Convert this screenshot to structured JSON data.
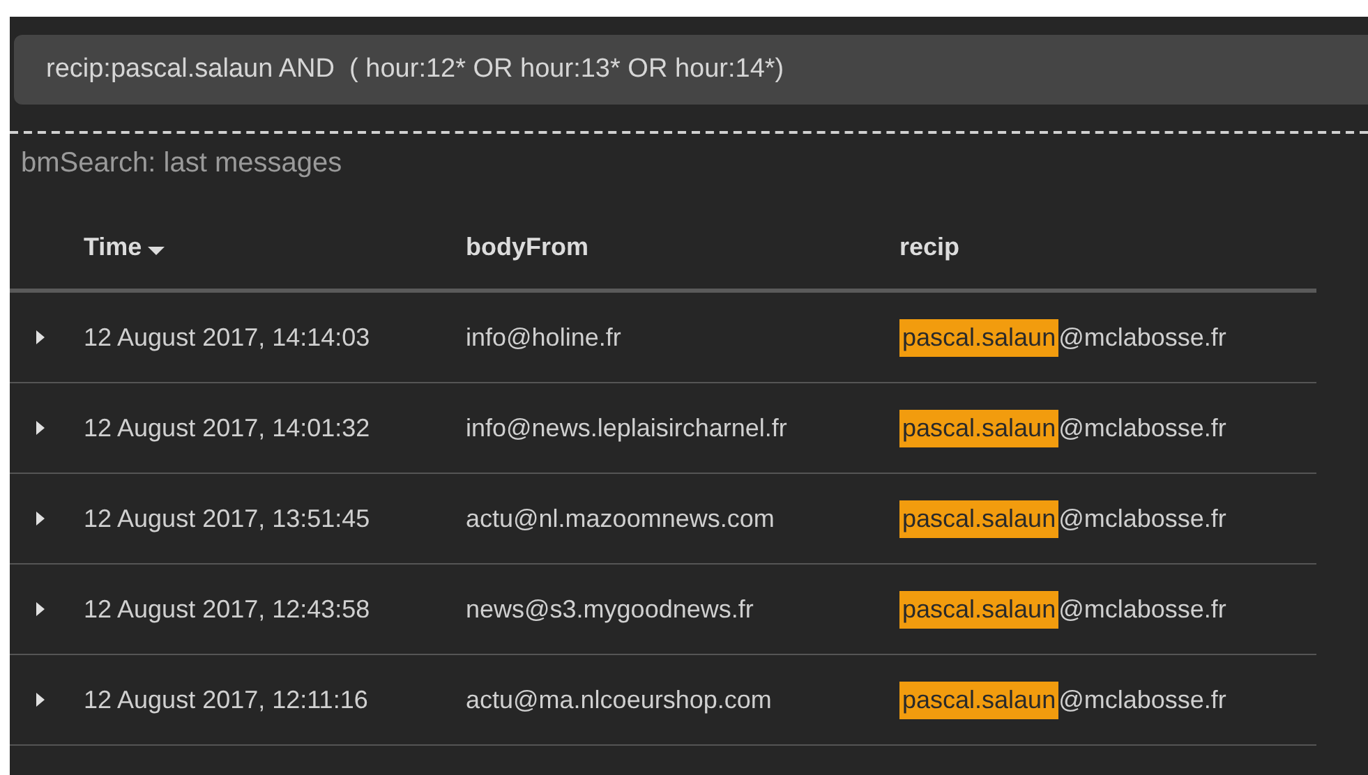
{
  "search": {
    "value": "recip:pascal.salaun AND  ( hour:12* OR hour:13* OR hour:14*)"
  },
  "panel_title": "bmSearch: last messages",
  "table": {
    "columns": [
      {
        "label": "Time",
        "sorted": true
      },
      {
        "label": "bodyFrom",
        "sorted": false
      },
      {
        "label": "recip",
        "sorted": false
      }
    ],
    "rows": [
      {
        "expanded": false,
        "time": "12 August 2017, 14:14:03",
        "body_from": "info@holine.fr",
        "recip": {
          "highlight": "pascal.salaun",
          "rest": "@mclabosse.fr"
        }
      },
      {
        "expanded": false,
        "time": "12 August 2017, 14:01:32",
        "body_from": "info@news.leplaisircharnel.fr",
        "recip": {
          "highlight": "pascal.salaun",
          "rest": "@mclabosse.fr"
        }
      },
      {
        "expanded": false,
        "time": "12 August 2017, 13:51:45",
        "body_from": "actu@nl.mazoomnews.com",
        "recip": {
          "highlight": "pascal.salaun",
          "rest": "@mclabosse.fr"
        }
      },
      {
        "expanded": false,
        "time": "12 August 2017, 12:43:58",
        "body_from": "news@s3.mygoodnews.fr",
        "recip": {
          "highlight": "pascal.salaun",
          "rest": "@mclabosse.fr"
        }
      },
      {
        "expanded": false,
        "time": "12 August 2017, 12:11:16",
        "body_from": "actu@ma.nlcoeurshop.com",
        "recip": {
          "highlight": "pascal.salaun",
          "rest": "@mclabosse.fr"
        }
      }
    ]
  }
}
